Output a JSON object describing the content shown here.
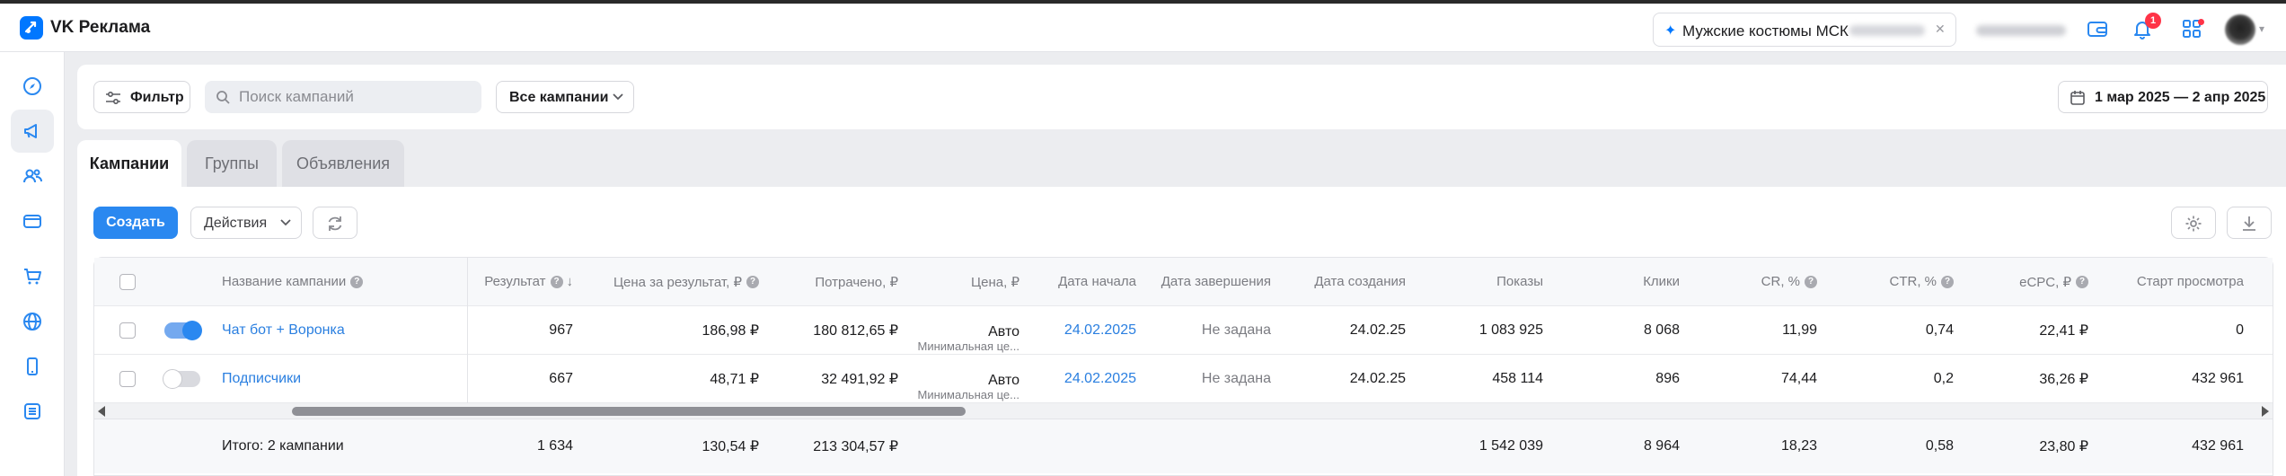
{
  "app": {
    "title": "VK Реклама",
    "accent_color": "#0077ff",
    "project_name": "Мужские костюмы МСК",
    "notifications_count": "1"
  },
  "sidebar": {
    "items": [
      {
        "icon": "compass-icon"
      },
      {
        "icon": "megaphone-icon",
        "active": true
      },
      {
        "icon": "users-icon"
      },
      {
        "icon": "wallet-icon"
      },
      {
        "icon": "cart-icon"
      },
      {
        "icon": "globe-icon"
      },
      {
        "icon": "phone-icon"
      },
      {
        "icon": "list-icon"
      }
    ]
  },
  "filterbar": {
    "filter_label": "Фильтр",
    "search_placeholder": "Поиск кампаний",
    "campaigns_select": "Все кампании",
    "date_range": "1 мар 2025 — 2 апр 2025"
  },
  "tabs": [
    {
      "label": "Кампании",
      "active": true
    },
    {
      "label": "Группы",
      "active": false
    },
    {
      "label": "Объявления",
      "active": false
    }
  ],
  "toolbar": {
    "create_label": "Создать",
    "actions_label": "Действия"
  },
  "table": {
    "headers": {
      "name": "Название кампании",
      "result": "Результат",
      "cost_per_result": "Цена за результат, ₽",
      "spent": "Потрачено, ₽",
      "price": "Цена, ₽",
      "start_date": "Дата начала",
      "end_date": "Дата завершения",
      "created_date": "Дата создания",
      "impressions": "Показы",
      "clicks": "Клики",
      "cr": "CR, %",
      "ctr": "CTR, %",
      "ecpc": "eCPC, ₽",
      "view_start": "Старт просмотра"
    },
    "rows": [
      {
        "enabled": true,
        "name": "Чат бот + Воронка",
        "result": "967",
        "cost_per_result": "186,98 ₽",
        "spent": "180 812,65 ₽",
        "price_main": "Авто",
        "price_sub": "Минимальная це...",
        "start_date": "24.02.2025",
        "end_date": "Не задана",
        "created_date": "24.02.25",
        "impressions": "1 083 925",
        "clicks": "8 068",
        "cr": "11,99",
        "ctr": "0,74",
        "ecpc": "22,41 ₽",
        "view_start": "0"
      },
      {
        "enabled": false,
        "name": "Подписчики",
        "result": "667",
        "cost_per_result": "48,71 ₽",
        "spent": "32 491,92 ₽",
        "price_main": "Авто",
        "price_sub": "Минимальная це...",
        "start_date": "24.02.2025",
        "end_date": "Не задана",
        "created_date": "24.02.25",
        "impressions": "458 114",
        "clicks": "896",
        "cr": "74,44",
        "ctr": "0,2",
        "ecpc": "36,26 ₽",
        "view_start": "432 961"
      }
    ],
    "total": {
      "label": "Итого: 2 кампании",
      "result": "1 634",
      "cost_per_result": "130,54 ₽",
      "spent": "213 304,57 ₽",
      "impressions": "1 542 039",
      "clicks": "8 964",
      "cr": "18,23",
      "ctr": "0,58",
      "ecpc": "23,80 ₽",
      "view_start": "432 961"
    }
  }
}
